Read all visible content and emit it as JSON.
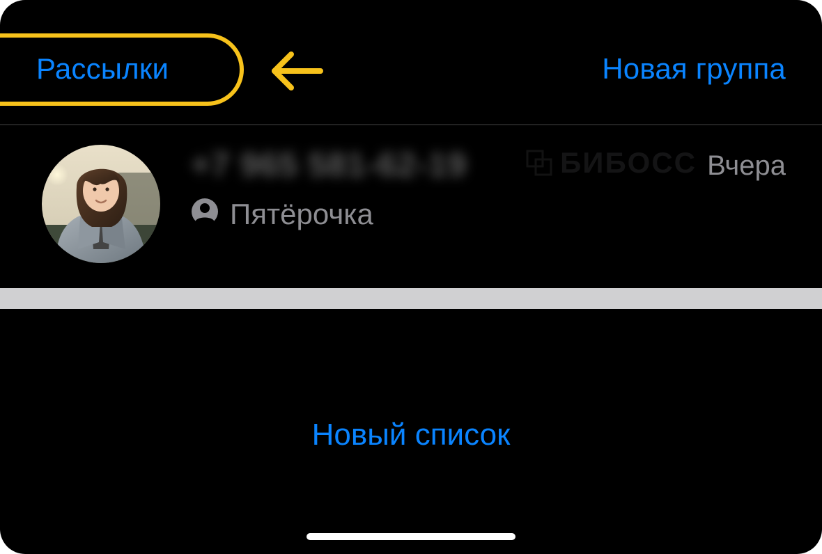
{
  "nav": {
    "back_label": "Рассылки",
    "right_label": "Новая группа"
  },
  "chat": {
    "title": "+7 965 581-62-19",
    "subtitle": "Пятёрочка",
    "time": "Вчера"
  },
  "footer": {
    "new_list_label": "Новый список"
  },
  "watermark": {
    "text": "БИБОСС"
  },
  "colors": {
    "accent": "#0a84ff",
    "highlight": "#f7c21b"
  }
}
